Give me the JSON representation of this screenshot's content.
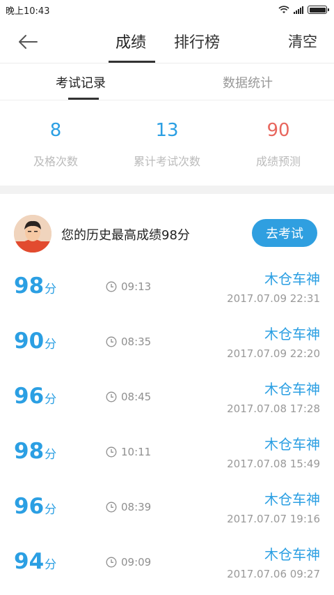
{
  "status_bar": {
    "time": "晚上10:43",
    "battery_level": 1.0
  },
  "header": {
    "tabs": [
      {
        "label": "成绩",
        "active": true
      },
      {
        "label": "排行榜",
        "active": false
      }
    ],
    "clear_label": "清空"
  },
  "subtabs": [
    {
      "label": "考试记录",
      "active": true
    },
    {
      "label": "数据统计",
      "active": false
    }
  ],
  "stats": [
    {
      "value": "8",
      "label": "及格次数",
      "color": "#2b9fe3"
    },
    {
      "value": "13",
      "label": "累计考试次数",
      "color": "#2b9fe3"
    },
    {
      "value": "90",
      "label": "成绩预测",
      "color": "#e8675e"
    }
  ],
  "best": {
    "text": "您的历史最高成绩98分",
    "button_label": "去考试"
  },
  "records": [
    {
      "score": "98",
      "unit": "分",
      "duration": "09:13",
      "name": "木仓车神",
      "datetime": "2017.07.09  22:31"
    },
    {
      "score": "90",
      "unit": "分",
      "duration": "08:35",
      "name": "木仓车神",
      "datetime": "2017.07.09  22:20"
    },
    {
      "score": "96",
      "unit": "分",
      "duration": "08:45",
      "name": "木仓车神",
      "datetime": "2017.07.08  17:28"
    },
    {
      "score": "98",
      "unit": "分",
      "duration": "10:11",
      "name": "木仓车神",
      "datetime": "2017.07.08  15:49"
    },
    {
      "score": "96",
      "unit": "分",
      "duration": "08:39",
      "name": "木仓车神",
      "datetime": "2017.07.07  19:16"
    },
    {
      "score": "94",
      "unit": "分",
      "duration": "09:09",
      "name": "木仓车神",
      "datetime": "2017.07.06  09:27"
    }
  ],
  "colors": {
    "accent": "#2b9fe3",
    "button": "#2f9fe0",
    "prediction": "#e8675e"
  }
}
